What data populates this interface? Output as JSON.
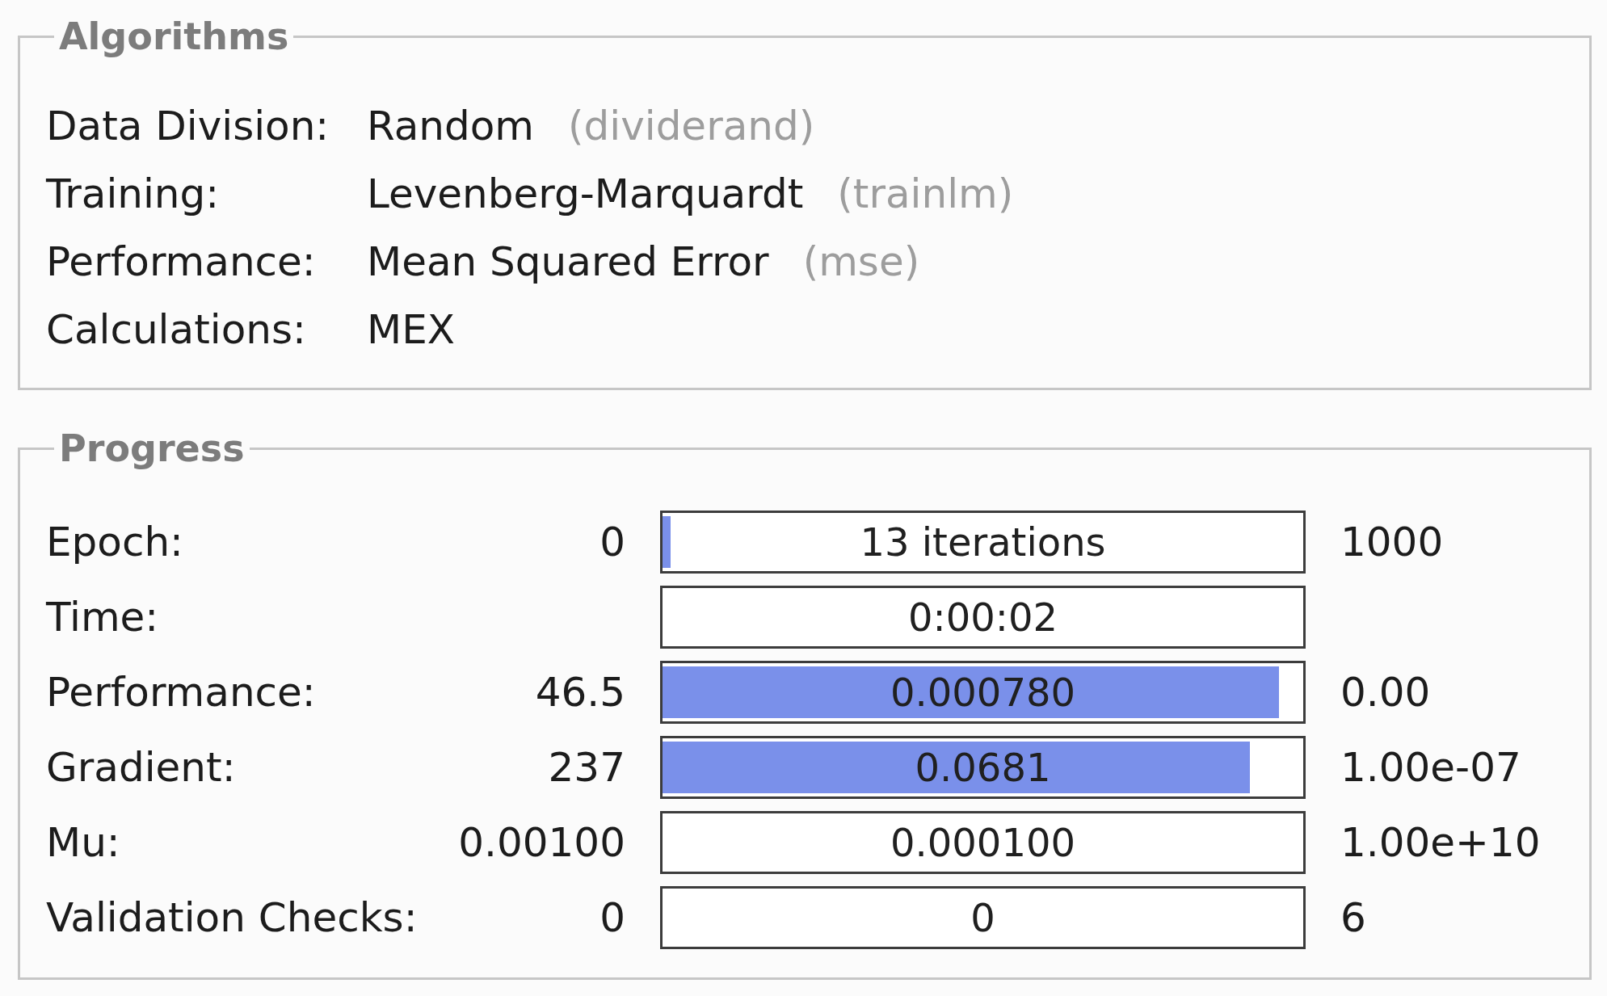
{
  "algorithms": {
    "title": "Algorithms",
    "rows": [
      {
        "label": "Data Division:",
        "value": "Random",
        "function": "(dividerand)"
      },
      {
        "label": "Training:",
        "value": "Levenberg-Marquardt",
        "function": "(trainlm)"
      },
      {
        "label": "Performance:",
        "value": "Mean Squared Error",
        "function": "(mse)"
      },
      {
        "label": "Calculations:",
        "value": "MEX"
      }
    ]
  },
  "progress": {
    "title": "Progress",
    "rows": [
      {
        "label": "Epoch:",
        "start_value": "0",
        "bar_text": "13 iterations",
        "level": 0.013,
        "end_value": "1000"
      },
      {
        "label": "Time:",
        "bar_text": "0:00:02"
      },
      {
        "label": "Performance:",
        "start_value": "46.5",
        "bar_text": "0.000780",
        "level": 0.955,
        "end_value": "0.00"
      },
      {
        "label": "Gradient:",
        "start_value": "237",
        "bar_text": "0.0681",
        "level": 0.91,
        "end_value": "1.00e-07"
      },
      {
        "label": "Mu:",
        "start_value": "0.00100",
        "bar_text": "0.000100",
        "end_value": "1.00e+10"
      },
      {
        "label": "Validation Checks:",
        "start_value": "0",
        "bar_text": "0",
        "end_value": "6"
      }
    ]
  }
}
